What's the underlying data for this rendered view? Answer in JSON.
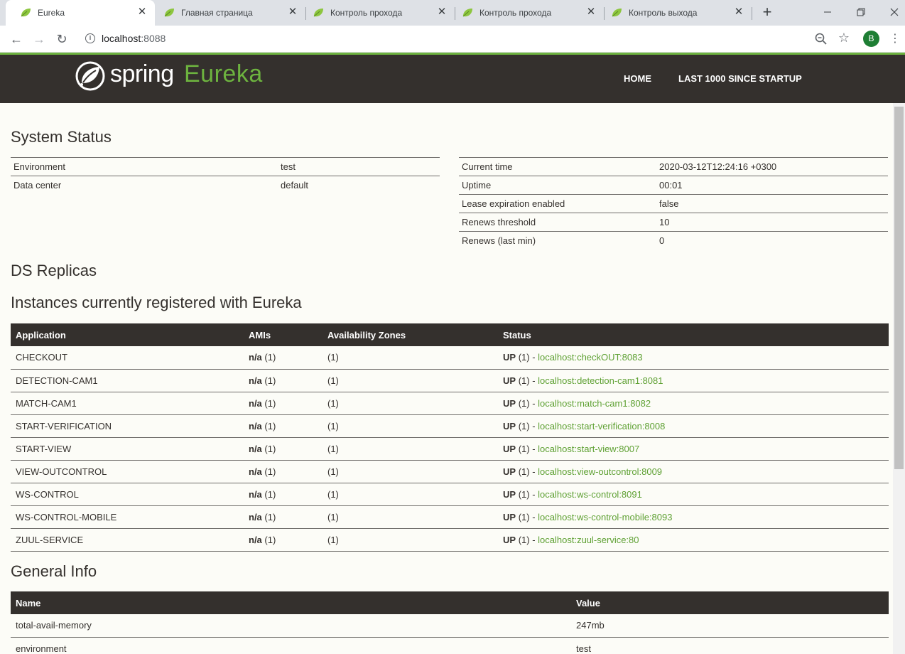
{
  "browser": {
    "tabs": [
      {
        "title": "Eureka",
        "active": true
      },
      {
        "title": "Главная страница",
        "active": false
      },
      {
        "title": "Контроль прохода",
        "active": false
      },
      {
        "title": "Контроль прохода",
        "active": false
      },
      {
        "title": "Контроль выхода",
        "active": false
      }
    ],
    "url_host": "localhost",
    "url_port": ":8088",
    "profile_initial": "B",
    "colors": {
      "accent": "#6db33f",
      "header": "#34302d",
      "profile": "#1e7e34"
    }
  },
  "header": {
    "logo_spring": "spring",
    "logo_eureka": "Eureka",
    "nav": {
      "home": "HOME",
      "last": "LAST 1000 SINCE STARTUP"
    }
  },
  "system_status": {
    "title": "System Status",
    "left": [
      {
        "label": "Environment",
        "value": "test"
      },
      {
        "label": "Data center",
        "value": "default"
      }
    ],
    "right": [
      {
        "label": "Current time",
        "value": "2020-03-12T12:24:16 +0300"
      },
      {
        "label": "Uptime",
        "value": "00:01"
      },
      {
        "label": "Lease expiration enabled",
        "value": "false"
      },
      {
        "label": "Renews threshold",
        "value": "10"
      },
      {
        "label": "Renews (last min)",
        "value": "0"
      }
    ]
  },
  "ds_replicas": {
    "title": "DS Replicas"
  },
  "instances": {
    "title": "Instances currently registered with Eureka",
    "headers": [
      "Application",
      "AMIs",
      "Availability Zones",
      "Status"
    ],
    "rows": [
      {
        "app": "CHECKOUT",
        "ami": "n/a",
        "ami_count": "(1)",
        "zones": "(1)",
        "status": "UP",
        "status_count": "(1) -",
        "link": "localhost:checkOUT:8083"
      },
      {
        "app": "DETECTION-CAM1",
        "ami": "n/a",
        "ami_count": "(1)",
        "zones": "(1)",
        "status": "UP",
        "status_count": "(1) -",
        "link": "localhost:detection-cam1:8081"
      },
      {
        "app": "MATCH-CAM1",
        "ami": "n/a",
        "ami_count": "(1)",
        "zones": "(1)",
        "status": "UP",
        "status_count": "(1) -",
        "link": "localhost:match-cam1:8082"
      },
      {
        "app": "START-VERIFICATION",
        "ami": "n/a",
        "ami_count": "(1)",
        "zones": "(1)",
        "status": "UP",
        "status_count": "(1) -",
        "link": "localhost:start-verification:8008"
      },
      {
        "app": "START-VIEW",
        "ami": "n/a",
        "ami_count": "(1)",
        "zones": "(1)",
        "status": "UP",
        "status_count": "(1) -",
        "link": "localhost:start-view:8007"
      },
      {
        "app": "VIEW-OUTCONTROL",
        "ami": "n/a",
        "ami_count": "(1)",
        "zones": "(1)",
        "status": "UP",
        "status_count": "(1) -",
        "link": "localhost:view-outcontrol:8009"
      },
      {
        "app": "WS-CONTROL",
        "ami": "n/a",
        "ami_count": "(1)",
        "zones": "(1)",
        "status": "UP",
        "status_count": "(1) -",
        "link": "localhost:ws-control:8091"
      },
      {
        "app": "WS-CONTROL-MOBILE",
        "ami": "n/a",
        "ami_count": "(1)",
        "zones": "(1)",
        "status": "UP",
        "status_count": "(1) -",
        "link": "localhost:ws-control-mobile:8093"
      },
      {
        "app": "ZUUL-SERVICE",
        "ami": "n/a",
        "ami_count": "(1)",
        "zones": "(1)",
        "status": "UP",
        "status_count": "(1) -",
        "link": "localhost:zuul-service:80"
      }
    ]
  },
  "general_info": {
    "title": "General Info",
    "headers": [
      "Name",
      "Value"
    ],
    "rows": [
      {
        "name": "total-avail-memory",
        "value": "247mb"
      },
      {
        "name": "environment",
        "value": "test"
      }
    ]
  }
}
